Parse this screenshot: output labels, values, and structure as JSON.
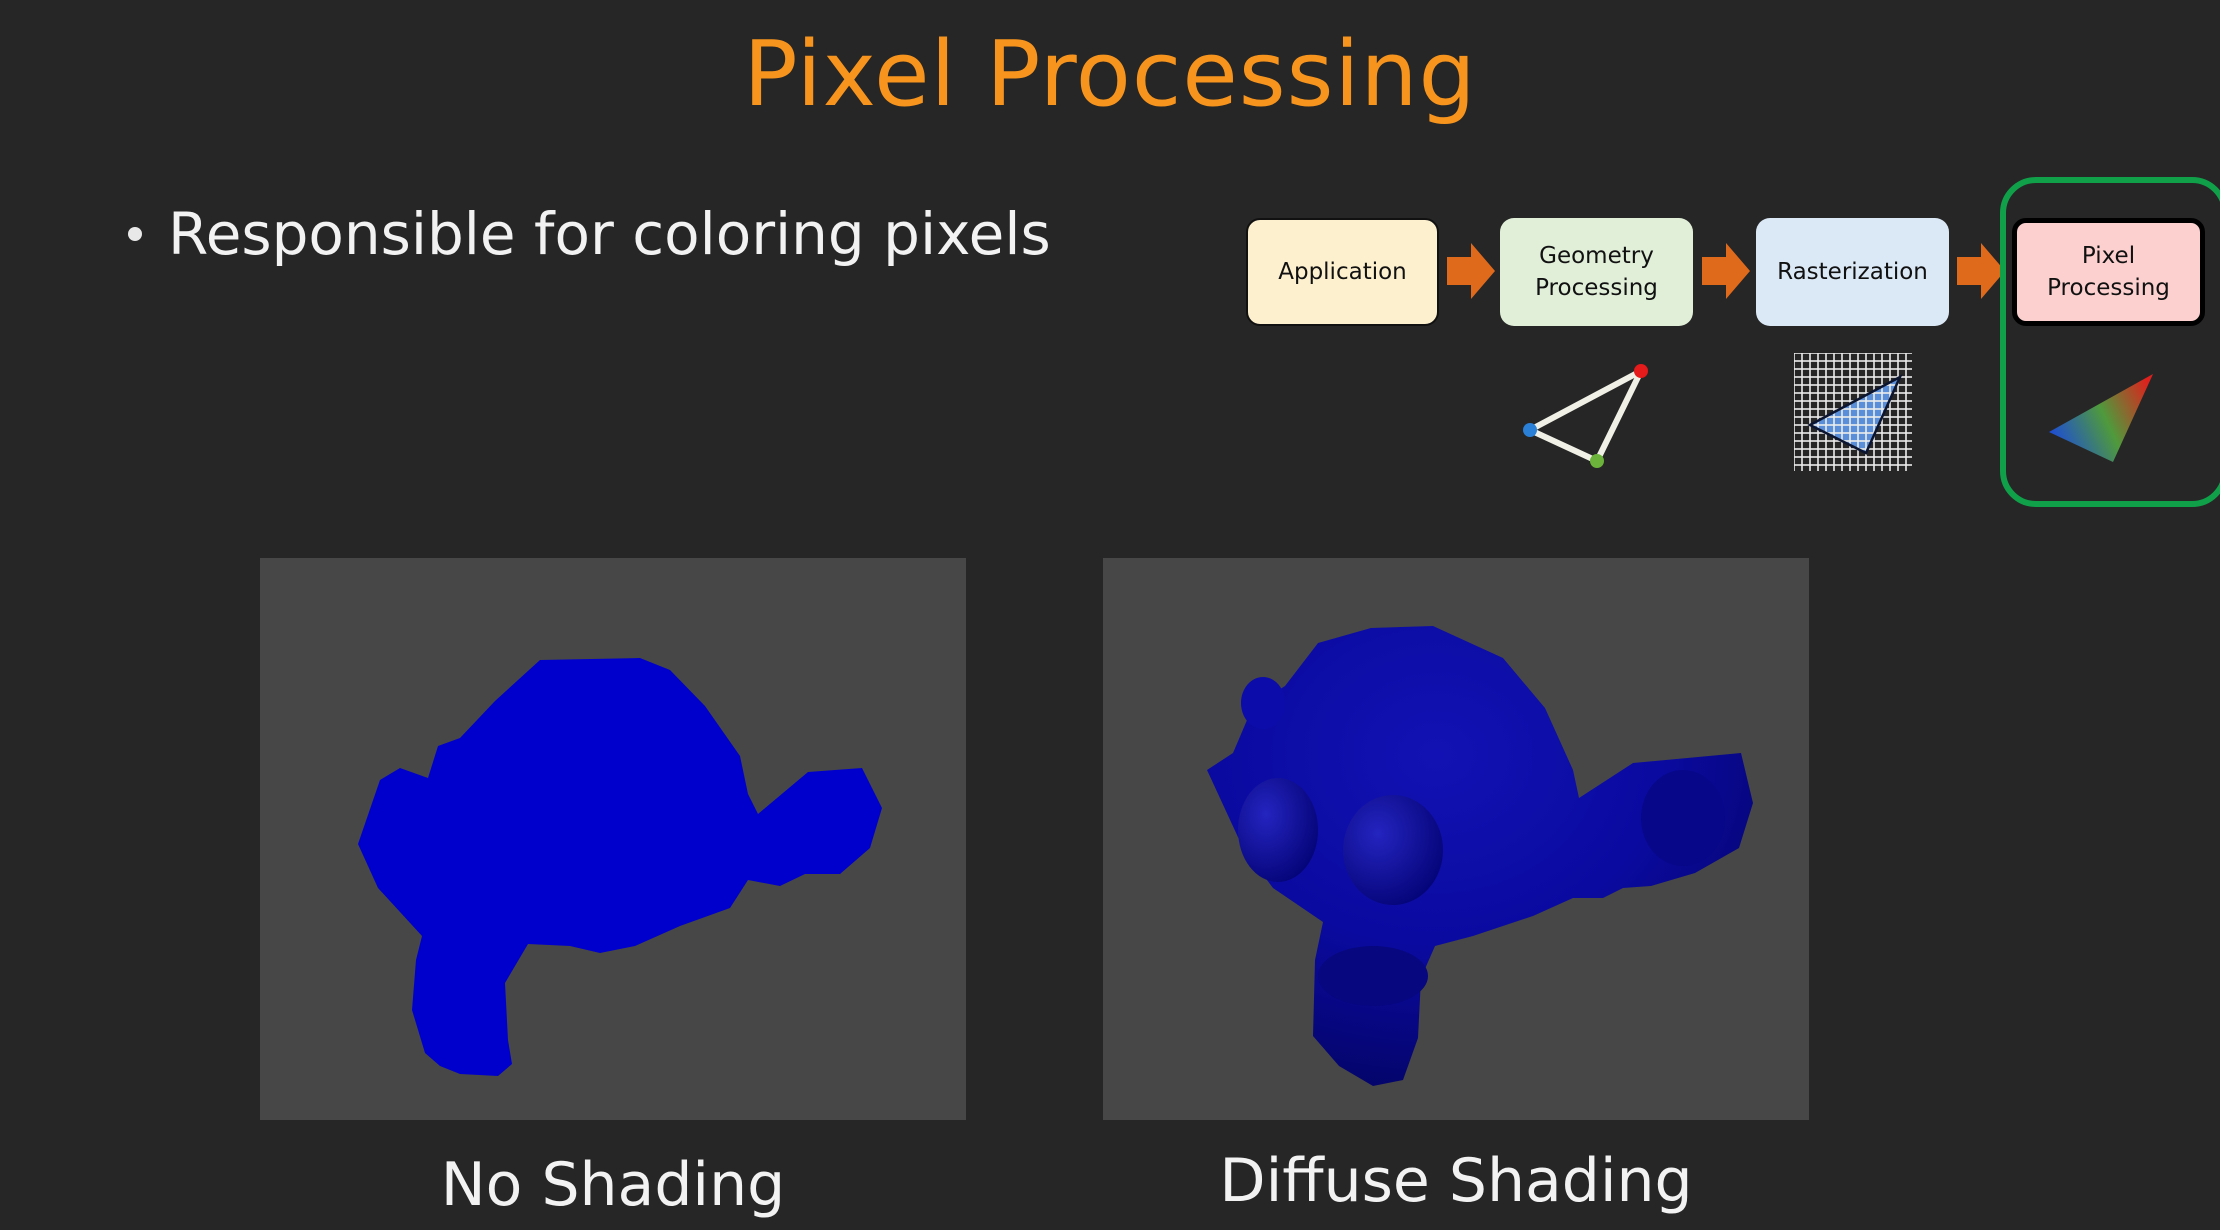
{
  "title": "Pixel Processing",
  "bullets": [
    "Responsible for coloring pixels"
  ],
  "pipeline": {
    "stages": [
      {
        "label": "Application",
        "color": "#fdf0cf"
      },
      {
        "label": "Geometry\nProcessing",
        "color": "#e1efd9"
      },
      {
        "label": "Rasterization",
        "color": "#dbe8f5"
      },
      {
        "label": "Pixel\nProcessing",
        "color": "#fbd0cf"
      }
    ],
    "arrow_color": "#e06a1b",
    "highlight_color": "#10a04a"
  },
  "panels": [
    {
      "caption": "No Shading",
      "object_color": "#0000cc"
    },
    {
      "caption": "Diffuse Shading",
      "object_color": "#0a0aa0"
    }
  ]
}
